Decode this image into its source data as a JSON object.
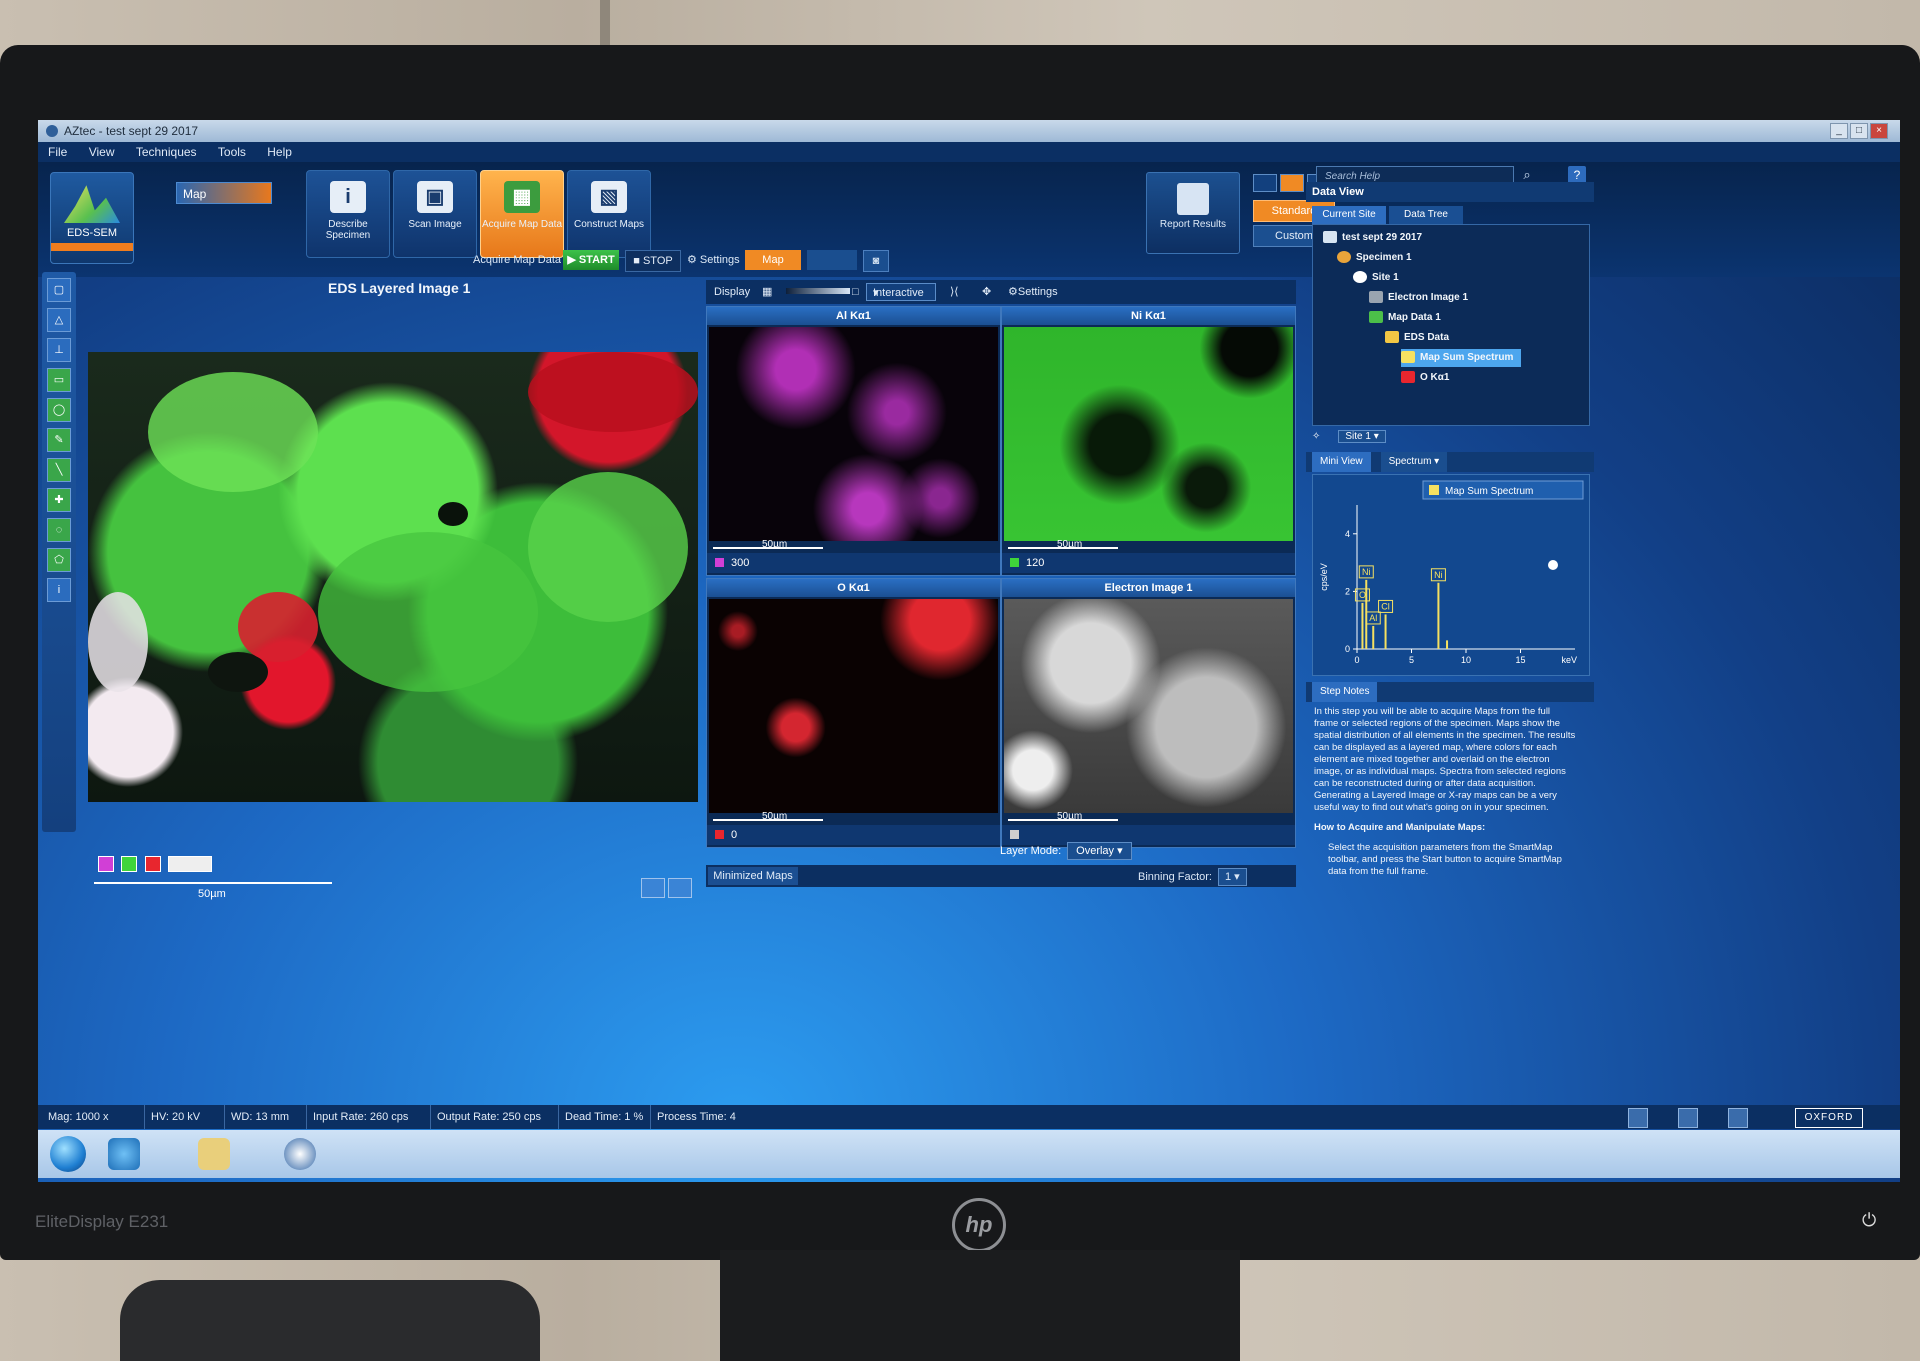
{
  "window": {
    "title": "AZtec - test sept 29 2017"
  },
  "menu": [
    "File",
    "View",
    "Techniques",
    "Tools",
    "Help"
  ],
  "ribbon": {
    "eds_tile": "EDS-SEM",
    "mode_select": "Map",
    "steps": [
      {
        "label": "Describe Specimen",
        "icon": "info-icon",
        "active": false
      },
      {
        "label": "Scan Image",
        "icon": "image-icon",
        "active": false
      },
      {
        "label": "Acquire Map Data",
        "icon": "map-icon",
        "active": true
      },
      {
        "label": "Construct Maps",
        "icon": "construct-icon",
        "active": false
      }
    ],
    "report": "Report Results",
    "layout_standard": "Standard",
    "layout_custom": "Custom",
    "search_placeholder": "Search Help"
  },
  "acquire_bar": {
    "label": "Acquire Map Data",
    "start": "START",
    "stop": "STOP",
    "settings": "Settings",
    "map_tab": "Map"
  },
  "layered": {
    "title": "EDS Layered Image 1",
    "scale": "50µm"
  },
  "display_bar": {
    "display": "Display",
    "mode": "Interactive",
    "settings": "Settings"
  },
  "maps": [
    {
      "title": "Al Kα1",
      "scale": "50µm",
      "value": "300",
      "color": "#d13fd6"
    },
    {
      "title": "Ni Kα1",
      "scale": "50µm",
      "value": "120",
      "color": "#3fd43a"
    },
    {
      "title": "O Kα1",
      "scale": "50µm",
      "value": "0",
      "color": "#e8262e"
    },
    {
      "title": "Electron Image 1",
      "scale": "50µm",
      "value": "",
      "color": "#cfcfcf"
    }
  ],
  "layer_mode": {
    "label": "Layer Mode:",
    "value": "Overlay"
  },
  "minimized_maps": "Minimized Maps",
  "binning": {
    "label": "Binning Factor:",
    "value": "1"
  },
  "data_view": {
    "title": "Data View",
    "tabs": [
      "Current Site",
      "Data Tree"
    ],
    "tree": [
      {
        "label": "test sept 29 2017",
        "depth": 0
      },
      {
        "label": "Specimen 1",
        "depth": 1
      },
      {
        "label": "Site 1",
        "depth": 2
      },
      {
        "label": "Electron Image 1",
        "depth": 3
      },
      {
        "label": "Map Data 1",
        "depth": 3
      },
      {
        "label": "EDS Data",
        "depth": 4
      },
      {
        "label": "Map Sum Spectrum",
        "depth": 5,
        "selected": true
      },
      {
        "label": "O Kα1",
        "depth": 5
      }
    ],
    "site_select": "Site 1"
  },
  "mini_view": {
    "tab": "Mini View",
    "select": "Spectrum",
    "legend": "Map Sum Spectrum"
  },
  "chart_data": {
    "type": "line",
    "title": "",
    "xlabel": "keV",
    "ylabel": "cps/eV",
    "xlim": [
      0,
      20
    ],
    "ylim": [
      0,
      5
    ],
    "xticks": [
      0,
      5,
      10,
      15
    ],
    "yticks": [
      0,
      2,
      4
    ],
    "peaks": [
      {
        "x": 0.5,
        "y": 1.6,
        "label": "O"
      },
      {
        "x": 0.85,
        "y": 2.4,
        "label": "Ni"
      },
      {
        "x": 1.49,
        "y": 0.8,
        "label": "Al"
      },
      {
        "x": 2.62,
        "y": 1.2,
        "label": "Cl"
      },
      {
        "x": 7.47,
        "y": 2.3,
        "label": "Ni"
      },
      {
        "x": 8.26,
        "y": 0.3,
        "label": ""
      }
    ]
  },
  "step_notes": {
    "tab": "Step Notes",
    "paragraph1": "In this step you will be able to acquire Maps from the full frame or selected regions of the specimen. Maps show the spatial distribution of all elements in the specimen. The results can be displayed as a layered map, where colors for each element are mixed together and overlaid on the electron image, or as individual maps. Spectra from selected regions can be reconstructed during or after data acquisition. Generating a Layered Image or X-ray maps can be a very useful way to find out what's going on in your specimen.",
    "heading": "How to Acquire and Manipulate Maps:",
    "bullet1": "Select the acquisition parameters from the SmartMap toolbar, and press the Start button to acquire SmartMap data from the full frame."
  },
  "status_bar": {
    "mag": "Mag: 1000 x",
    "hv": "HV: 20 kV",
    "wd": "WD: 13 mm",
    "input_rate": "Input Rate: 260 cps",
    "output_rate": "Output Rate: 250 cps",
    "dead_time": "Dead Time: 1 %",
    "process_time": "Process Time: 4",
    "brand": "OXFORD"
  },
  "monitor": {
    "model": "EliteDisplay E231",
    "brand": "hp"
  }
}
